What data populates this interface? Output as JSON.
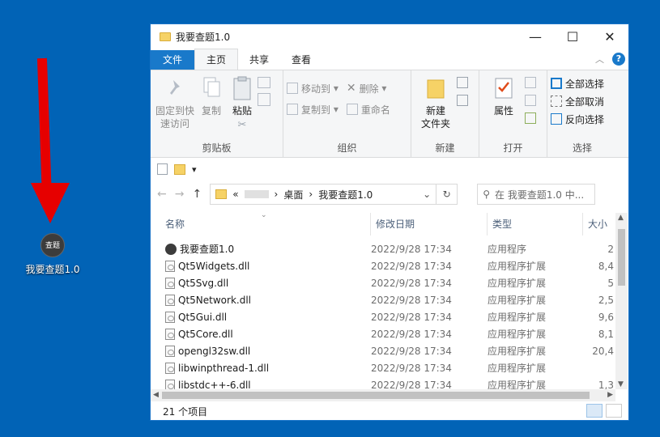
{
  "desktop": {
    "icon_label": "我要查题1.0",
    "icon_glyph": "查题"
  },
  "window": {
    "title": "我要查题1.0",
    "buttons": {
      "minimize": "—",
      "maximize": "☐",
      "close": "✕"
    }
  },
  "tabs": [
    "文件",
    "主页",
    "共享",
    "查看"
  ],
  "help_label": "?",
  "ribbon": {
    "clipboard": {
      "pin": "固定到快\n速访问",
      "copy": "复制",
      "paste": "粘贴",
      "name": "剪贴板"
    },
    "organize": {
      "move_to": "移动到",
      "copy_to": "复制到",
      "delete": "删除",
      "rename": "重命名",
      "name": "组织"
    },
    "new": {
      "new_folder": "新建\n文件夹",
      "name": "新建"
    },
    "open": {
      "properties": "属性",
      "name": "打开"
    },
    "select": {
      "select_all": "全部选择",
      "select_none": "全部取消",
      "invert": "反向选择",
      "name": "选择"
    }
  },
  "address": {
    "prefix": "«",
    "blurred": "",
    "crumb1": "桌面",
    "crumb2": "我要查题1.0",
    "search_placeholder": "在 我要查题1.0 中..."
  },
  "columns": [
    "名称",
    "修改日期",
    "类型",
    "大小"
  ],
  "files": [
    {
      "name": "我要查题1.0",
      "date": "2022/9/28 17:34",
      "type": "应用程序",
      "size": "2",
      "icon": "exe"
    },
    {
      "name": "Qt5Widgets.dll",
      "date": "2022/9/28 17:34",
      "type": "应用程序扩展",
      "size": "8,4",
      "icon": "dll"
    },
    {
      "name": "Qt5Svg.dll",
      "date": "2022/9/28 17:34",
      "type": "应用程序扩展",
      "size": "5",
      "icon": "dll"
    },
    {
      "name": "Qt5Network.dll",
      "date": "2022/9/28 17:34",
      "type": "应用程序扩展",
      "size": "2,5",
      "icon": "dll"
    },
    {
      "name": "Qt5Gui.dll",
      "date": "2022/9/28 17:34",
      "type": "应用程序扩展",
      "size": "9,6",
      "icon": "dll"
    },
    {
      "name": "Qt5Core.dll",
      "date": "2022/9/28 17:34",
      "type": "应用程序扩展",
      "size": "8,1",
      "icon": "dll"
    },
    {
      "name": "opengl32sw.dll",
      "date": "2022/9/28 17:34",
      "type": "应用程序扩展",
      "size": "20,4",
      "icon": "dll"
    },
    {
      "name": "libwinpthread-1.dll",
      "date": "2022/9/28 17:34",
      "type": "应用程序扩展",
      "size": "",
      "icon": "dll"
    },
    {
      "name": "libstdc++-6.dll",
      "date": "2022/9/28 17:34",
      "type": "应用程序扩展",
      "size": "1,3",
      "icon": "dll"
    }
  ],
  "status": {
    "count": "21 个项目"
  },
  "colors": {
    "desktop": "#0163b6",
    "accent": "#1979ca",
    "arrow": "#e60000"
  }
}
